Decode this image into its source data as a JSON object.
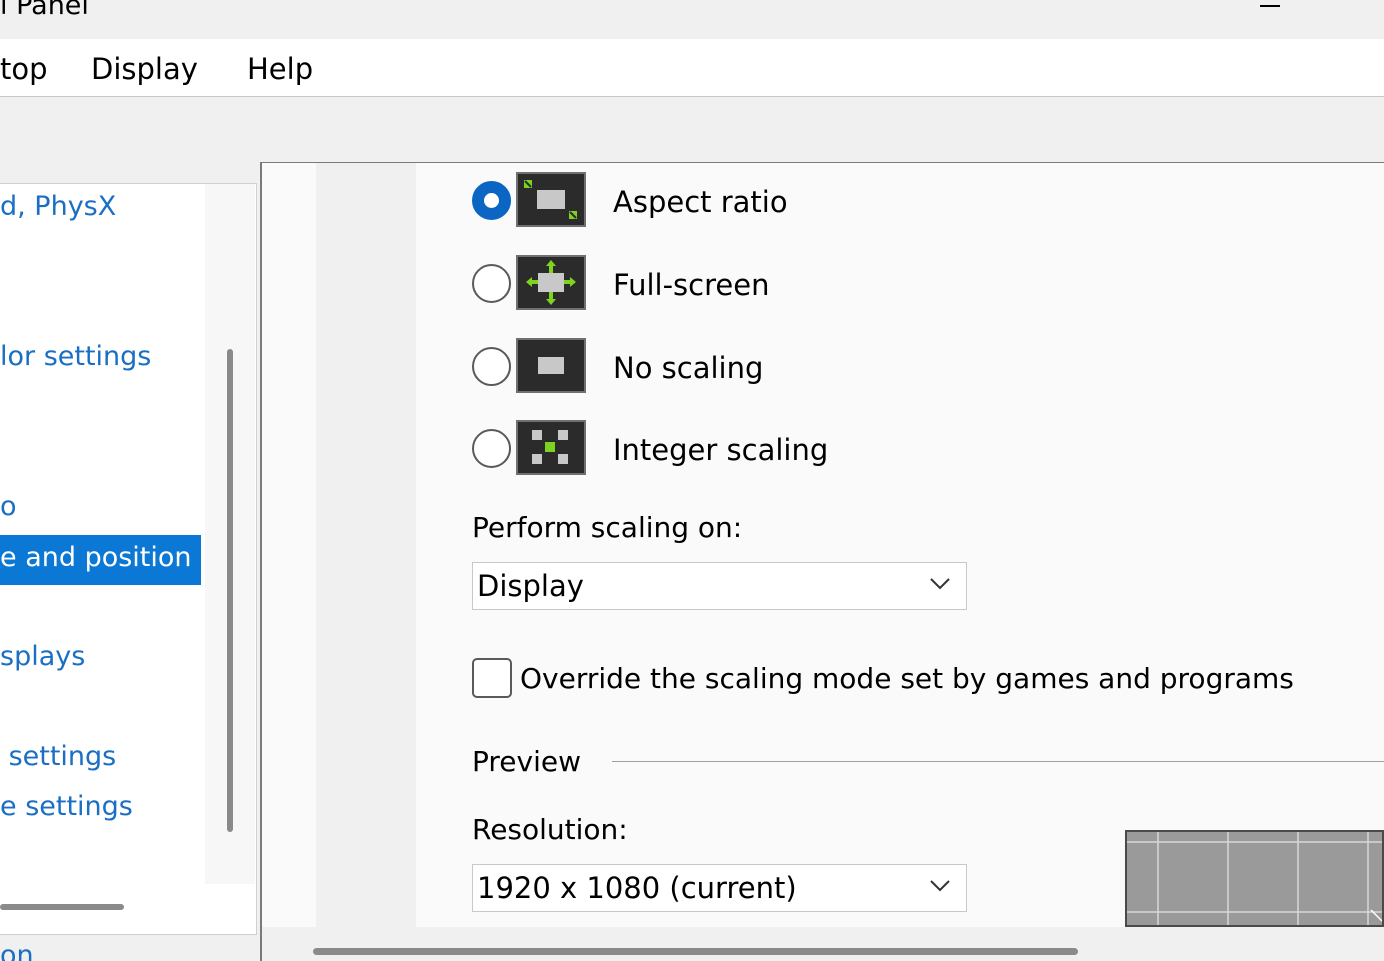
{
  "window": {
    "title": "l Panel"
  },
  "menu": [
    "top",
    "Display",
    "Help"
  ],
  "nav": {
    "items": [
      {
        "label": "d, PhysX",
        "selected": false
      },
      {
        "label": "lor settings",
        "selected": false
      },
      {
        "label": "o",
        "selected": false
      },
      {
        "label": "e and position",
        "selected": true
      },
      {
        "label": "splays",
        "selected": false
      },
      {
        "label": " settings",
        "selected": false
      },
      {
        "label": "e settings",
        "selected": false
      }
    ],
    "bottom_partial": "on"
  },
  "scaling": {
    "modes": [
      {
        "label": "Aspect ratio",
        "checked": true,
        "icon": "aspect-ratio-icon"
      },
      {
        "label": "Full-screen",
        "checked": false,
        "icon": "full-screen-icon"
      },
      {
        "label": "No scaling",
        "checked": false,
        "icon": "no-scaling-icon"
      },
      {
        "label": "Integer scaling",
        "checked": false,
        "icon": "integer-scaling-icon"
      }
    ],
    "perform_label": "Perform scaling on:",
    "perform_value": "Display",
    "override_label": "Override the scaling mode set by games and programs",
    "override_checked": false
  },
  "preview": {
    "label": "Preview",
    "resolution_label": "Resolution:",
    "resolution_value": "1920 x 1080 (current)"
  },
  "colors": {
    "accent": "#0a66c2",
    "selection": "#0a78d4",
    "link": "#1a6fc4",
    "icon_green": "#7ed321"
  }
}
